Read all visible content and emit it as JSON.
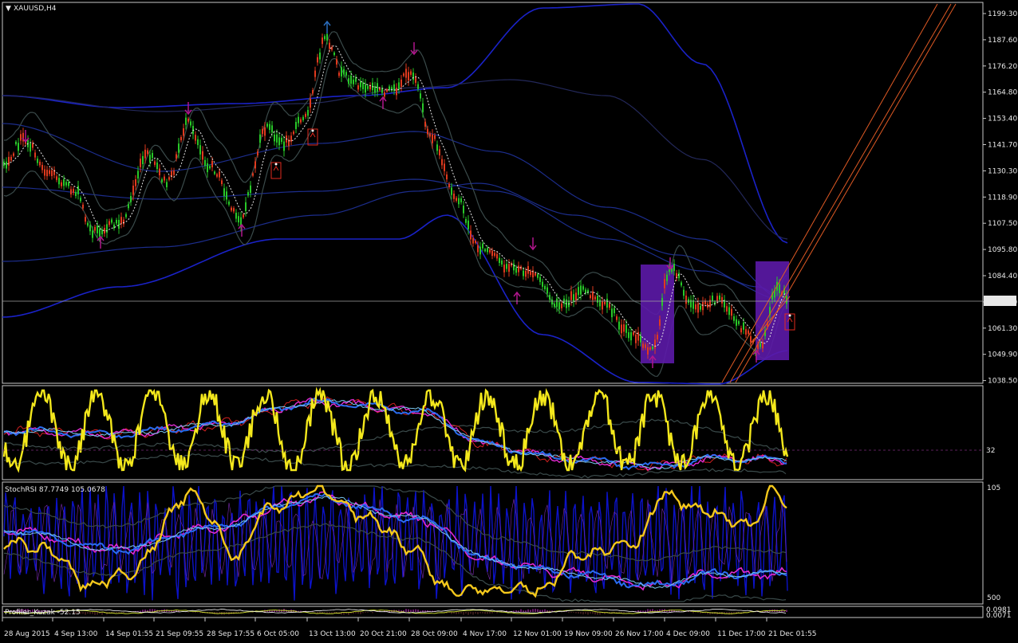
{
  "symbol_label": "XAUUSD,H4",
  "current_price": "1073.55",
  "price_ticks": [
    "1199.30",
    "1187.60",
    "1176.20",
    "1164.80",
    "1153.40",
    "1141.70",
    "1130.30",
    "1118.90",
    "1107.50",
    "1095.80",
    "1084.40",
    "1073.00",
    "1061.30",
    "1049.90",
    "1038.50"
  ],
  "indicator1": {
    "level_label": "32"
  },
  "indicator2": {
    "title": "StochRSI 87.7749 105.0678",
    "top_label": "105",
    "bottom_label": "500"
  },
  "indicator3": {
    "title": "Profiler_Kuzak -52.15",
    "labels": [
      "0.0981",
      "0.0071"
    ]
  },
  "time_ticks": [
    "28 Aug 2015",
    "4 Sep 13:00",
    "14 Sep 01:55",
    "21 Sep 09:55",
    "28 Sep 17:55",
    "6 Oct 05:00",
    "13 Oct 13:00",
    "20 Oct 21:00",
    "28 Oct 09:00",
    "4 Nov 17:00",
    "12 Nov 01:00",
    "19 Nov 09:00",
    "26 Nov 17:00",
    "4 Dec 09:00",
    "11 Dec 17:00",
    "21 Dec 01:55"
  ],
  "colors": {
    "background": "#000000",
    "frame": "#c8c8c8",
    "bull_candle": "#28c828",
    "bear_candle": "#e03a1e",
    "bollinger": "#3a4a4a",
    "envelope": "#1c2d8c",
    "envelope_strong": "#1a22c8",
    "signal_arrow": "#b0168c",
    "highlight_box": "#5c1aa8",
    "trend_line": "#e05a24",
    "osc_yellow": "#f4e81c",
    "osc_blue": "#2a6cf0",
    "osc_magenta": "#e02ad0",
    "osc_navy": "#0c12c8"
  }
}
